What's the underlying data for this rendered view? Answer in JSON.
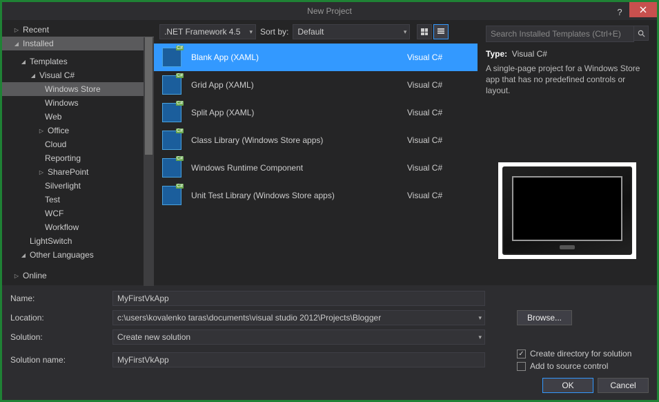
{
  "title": "New Project",
  "sidebar": {
    "recent": "Recent",
    "installed": "Installed",
    "templates": "Templates",
    "visual_csharp": "Visual C#",
    "items": [
      "Windows Store",
      "Windows",
      "Web",
      "Office",
      "Cloud",
      "Reporting",
      "SharePoint",
      "Silverlight",
      "Test",
      "WCF",
      "Workflow"
    ],
    "lightswitch": "LightSwitch",
    "other_lang": "Other Languages",
    "online": "Online"
  },
  "toolbar": {
    "framework": ".NET Framework 4.5",
    "sort_label": "Sort by:",
    "sort_value": "Default"
  },
  "templates": [
    {
      "name": "Blank App (XAML)",
      "lang": "Visual C#",
      "selected": true
    },
    {
      "name": "Grid App (XAML)",
      "lang": "Visual C#"
    },
    {
      "name": "Split App (XAML)",
      "lang": "Visual C#"
    },
    {
      "name": "Class Library (Windows Store apps)",
      "lang": "Visual C#"
    },
    {
      "name": "Windows Runtime Component",
      "lang": "Visual C#"
    },
    {
      "name": "Unit Test Library (Windows Store apps)",
      "lang": "Visual C#"
    }
  ],
  "search": {
    "placeholder": "Search Installed Templates (Ctrl+E)"
  },
  "details": {
    "type_label": "Type:",
    "type_value": "Visual C#",
    "description": "A single-page project for a Windows Store app that has no predefined controls or layout."
  },
  "form": {
    "name_label": "Name:",
    "name_value": "MyFirstVkApp",
    "location_label": "Location:",
    "location_value": "c:\\users\\kovalenko taras\\documents\\visual studio 2012\\Projects\\Blogger",
    "solution_label": "Solution:",
    "solution_value": "Create new solution",
    "solname_label": "Solution name:",
    "solname_value": "MyFirstVkApp",
    "browse": "Browse...",
    "chk1": "Create directory for solution",
    "chk2": "Add to source control",
    "ok": "OK",
    "cancel": "Cancel"
  }
}
